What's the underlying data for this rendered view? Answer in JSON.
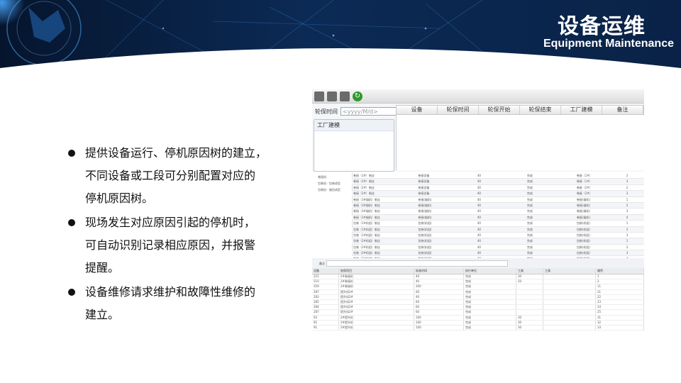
{
  "header": {
    "title_cn": "设备运维",
    "title_en": "Equipment Maintenance"
  },
  "bullets": [
    [
      "提供设备运行、停机原因树的建立，",
      "不同设备或工段可分别配置对应的",
      "停机原因树。"
    ],
    [
      "现场发生对应原因引起的停机时，",
      "可自动识别记录相应原因，并报警",
      "提醒。"
    ],
    [
      "设备维修请求维护和故障性维修的",
      "建立。"
    ]
  ],
  "app": {
    "filter_label": "轮保时间",
    "date_placeholder": "<yyyy/M/d>",
    "calendar_label": "15",
    "columns": [
      "设备",
      "轮保时间",
      "轮保开始",
      "轮保结束",
      "工厂建模",
      "备注"
    ],
    "tree_title": "工厂建模",
    "tree_items": [
      "卷接机",
      "包装机 · 包装成型",
      "包装机 · 烟包成型"
    ],
    "grid_rows": [
      [
        "卷接（1#）制丝",
        "卷接设备",
        "40",
        "完成",
        "卷接（1#）",
        "2"
      ],
      [
        "卷接（1#）制丝",
        "卷接设备",
        "40",
        "完成",
        "卷接（1#）",
        "3"
      ],
      [
        "卷接（2#）制丝",
        "卷接设备",
        "40",
        "完成",
        "卷接（2#）",
        "2"
      ],
      [
        "卷接（2#）制丝",
        "卷接设备",
        "40",
        "完成",
        "卷接（2#）",
        "3"
      ],
      [
        "卷接（3#烟机）制丝",
        "卷接(烟机)",
        "40",
        "完成",
        "卷接(烟机)",
        "1"
      ],
      [
        "卷接（3#烟机）制丝",
        "卷接(烟机)",
        "40",
        "完成",
        "卷接(烟机)",
        "2"
      ],
      [
        "卷接（3#烟机）制丝",
        "卷接(烟机)",
        "40",
        "完成",
        "卷接(烟机)",
        "3"
      ],
      [
        "卷接（3#烟机）制丝",
        "卷接(烟机)",
        "40",
        "完成",
        "卷接(烟机)",
        "4"
      ],
      [
        "包装（1#机组）制丝",
        "包装(机组)",
        "40",
        "完成",
        "包装(机组)",
        "1"
      ],
      [
        "包装（1#机组）制丝",
        "包装(机组)",
        "40",
        "完成",
        "包装(机组)",
        "2"
      ],
      [
        "包装（1#机组）制丝",
        "包装(机组)",
        "40",
        "完成",
        "包装(机组)",
        "3"
      ],
      [
        "包装（2#机组）制丝",
        "包装(机组)",
        "40",
        "完成",
        "包装(机组)",
        "1"
      ],
      [
        "包装（2#机组）制丝",
        "包装(机组)",
        "40",
        "完成",
        "包装(机组)",
        "2"
      ],
      [
        "包装（2#机组）制丝",
        "包装(机组)",
        "40",
        "完成",
        "包装(机组)",
        "3"
      ],
      [
        "包装（2#机组）制丝",
        "包装(机组)",
        "40",
        "完成",
        "包装(机组)",
        "4"
      ],
      [
        "提升（1#）制丝",
        "提升(1)",
        "40",
        "完成",
        "提升(1)",
        "2"
      ]
    ],
    "remark_label": "备注",
    "lower_columns": [
      "设备",
      "轮保项目",
      "标准时间",
      "执行单位",
      "工具",
      "工具",
      "顺序"
    ],
    "lower_rows": [
      [
        "215",
        "2#卷接机",
        "40",
        "完成",
        "30",
        "",
        "1"
      ],
      [
        "510",
        "2#卷接机",
        "40",
        "完成",
        "20",
        "",
        "2"
      ],
      [
        "359",
        "2#卷接机",
        "300",
        "完成",
        "",
        "",
        "11"
      ],
      [
        "287",
        "提升机2#",
        "60",
        "完成",
        "",
        "",
        "21"
      ],
      [
        "283",
        "提升机2#",
        "40",
        "完成",
        "",
        "",
        "22"
      ],
      [
        "285",
        "提升机2#",
        "60",
        "完成",
        "",
        "",
        "23"
      ],
      [
        "284",
        "提升机2#",
        "60",
        "完成",
        "",
        "",
        "24"
      ],
      [
        "287",
        "提升机2#",
        "60",
        "完成",
        "",
        "",
        "25"
      ],
      [
        "93",
        "2#提升机",
        "100",
        "完成",
        "30",
        "",
        "31"
      ],
      [
        "92",
        "2#提升机",
        "100",
        "完成",
        "30",
        "",
        "32"
      ],
      [
        "91",
        "2#提升机",
        "100",
        "完成",
        "30",
        "",
        "33"
      ]
    ]
  }
}
